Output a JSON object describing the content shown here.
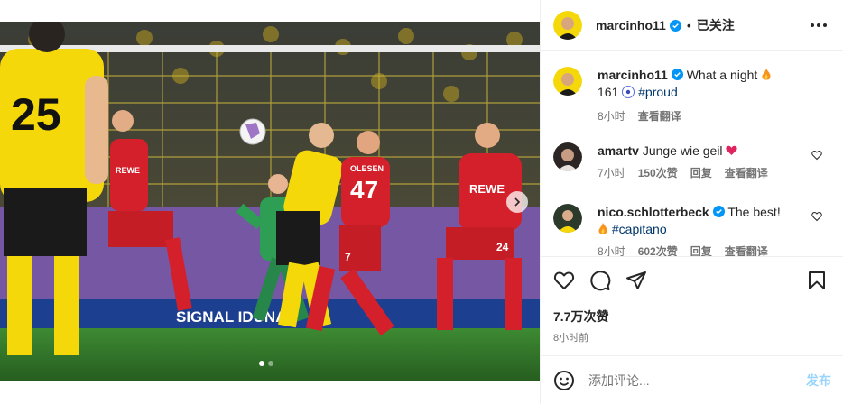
{
  "post": {
    "author": "marcinho11",
    "follow_state": "已关注",
    "separator": "•"
  },
  "caption": {
    "username": "marcinho11",
    "text_before": "What a night",
    "text_line2_prefix": "161",
    "hashtag": "#proud",
    "time": "8小时",
    "translate": "查看翻译"
  },
  "comments": [
    {
      "username": "amartv",
      "text": "Junge wie geil",
      "time": "7小时",
      "likes": "150次赞",
      "reply": "回复",
      "translate": "查看翻译"
    },
    {
      "username": "nico.schlotterbeck",
      "text": "The best!",
      "hashtag": "#capitano",
      "time": "8小时",
      "likes": "602次赞",
      "reply": "回复",
      "translate": "查看翻译"
    }
  ],
  "stats": {
    "likes": "7.7万次赞",
    "posted": "8小时前"
  },
  "composer": {
    "placeholder": "添加评论...",
    "post_label": "发布"
  },
  "carousel": {
    "slide_count": 2,
    "active_index": 0
  },
  "photo": {
    "jersey_numbers": [
      "25",
      "47",
      "7",
      "24"
    ],
    "jersey_names": [
      "OLESEN"
    ],
    "sponsor": "REWE",
    "board_text": "SIGNAL IDUNA"
  },
  "colors": {
    "verified": "#0095f6",
    "link": "#00376b",
    "accent": "#0095f6",
    "bvb_yellow": "#f5d80a",
    "koeln_red": "#d4202a",
    "pitch": "#2f7a2a"
  }
}
